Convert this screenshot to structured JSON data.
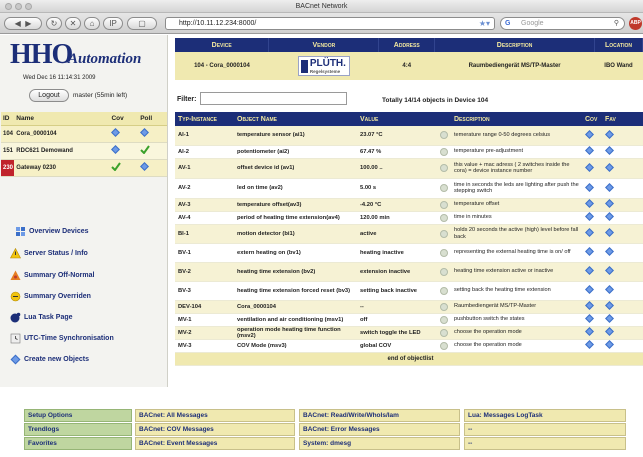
{
  "window": {
    "title": "BACnet Network"
  },
  "browser": {
    "url": "http://10.11.12.234:8000/",
    "search_placeholder": "Google",
    "addon_badge": "ABP"
  },
  "sidebar": {
    "logo_main": "HHO",
    "logo_sub": "Automation",
    "datetime": "Wed Dec 16 11:14:31 2009",
    "logout_label": "Logout",
    "user_status": "master (55min left)",
    "device_table": {
      "headers": [
        "ID",
        "Name",
        "Cov",
        "Poll"
      ],
      "rows": [
        {
          "id": "104",
          "name": "Cora_0000104",
          "cov": "arrow",
          "poll": "arrow"
        },
        {
          "id": "151",
          "name": "RDC621 Demowand",
          "cov": "arrow",
          "poll": "check"
        },
        {
          "id": "230",
          "name": "Gateway 0230",
          "cov": "check",
          "poll": "arrow"
        }
      ]
    },
    "menu": [
      {
        "label": "Overview Devices",
        "icon": "device-list-icon"
      },
      {
        "label": "Server Status / Info",
        "icon": "warning-triangle-icon"
      },
      {
        "label": "Summary Off-Normal",
        "icon": "alarm-icon"
      },
      {
        "label": "Summary Overriden",
        "icon": "override-icon"
      },
      {
        "label": "Lua Task Page",
        "icon": "lua-icon"
      },
      {
        "label": "UTC-Time Synchronisation",
        "icon": "clock-icon"
      },
      {
        "label": "Create new Objects",
        "icon": "create-object-icon"
      }
    ]
  },
  "device_header": {
    "headers": [
      "Device",
      "Vendor",
      "Address",
      "Description",
      "Location"
    ],
    "device": "104 - Cora_0000104",
    "vendor_logo": "PLÜTH.",
    "vendor_logo_sub": "Regelsysteme",
    "address": "4:4",
    "description": "Raumbediengerät MS/TP-Master",
    "location": "IBO Wand"
  },
  "filter": {
    "label": "Filter:",
    "value": ""
  },
  "object_summary": "Totally 14/14 objects in Device 104",
  "objects": {
    "headers": [
      "Typ-Instance",
      "Object Name",
      "Value",
      "",
      "Description",
      "Cov",
      "Fav"
    ],
    "rows": [
      {
        "type": "AI-1",
        "name": "temperature sensor (ai1)",
        "value": "23.07 °C",
        "desc": "temerature range 0-50 degrees celsius"
      },
      {
        "type": "AI-2",
        "name": "potentiometer (ai2)",
        "value": "67.47 %",
        "desc": "temperature pre-adjustment"
      },
      {
        "type": "AV-1",
        "name": "offset device id (av1)",
        "value": "100.00 ..",
        "desc": "this value + mac adress ( 2 switches inside the cora) = device instance number"
      },
      {
        "type": "AV-2",
        "name": "led on time (av2)",
        "value": "5.00 s",
        "desc": "time in seconds the leds are lighting after push the stepping switch"
      },
      {
        "type": "AV-3",
        "name": "temperature offset(av3)",
        "value": "-4.20 °C",
        "desc": "temperature offset"
      },
      {
        "type": "AV-4",
        "name": "period of heating time extension(av4)",
        "value": "120.00 min",
        "desc": "time in minutes"
      },
      {
        "type": "BI-1",
        "name": "motion detector (bi1)",
        "value": "active",
        "desc": "holds 20 seconds the active (high) level before fall back"
      },
      {
        "type": "BV-1",
        "name": "extern heating on (bv1)",
        "value": "heating inactive",
        "desc": "representing the external heating time is on/ off"
      },
      {
        "type": "BV-2",
        "name": "heating time extension (bv2)",
        "value": "extension inactive",
        "desc": "heating time extension active or inactive"
      },
      {
        "type": "BV-3",
        "name": "heating time extension forced reset (bv3)",
        "value": "setting back inactive",
        "desc": "setting back the heating time extension"
      },
      {
        "type": "DEV-104",
        "name": "Cora_0000104",
        "value": "--",
        "desc": "Raumbediengerät MS/TP-Master"
      },
      {
        "type": "MV-1",
        "name": "ventilation and air conditioning (msv1)",
        "value": "off",
        "desc": "pushbutton switch the states"
      },
      {
        "type": "MV-2",
        "name": "operation mode heating time function (msv2)",
        "value": "switch toggle the LED",
        "desc": "choose the operation mode"
      },
      {
        "type": "MV-3",
        "name": "COV Mode (msv3)",
        "value": "global COV",
        "desc": "choose the operation mode"
      }
    ],
    "end_label": "end of objectlist"
  },
  "bottom_menu": [
    [
      "Setup Options",
      "BACnet: All Messages",
      "BACnet: Read/Write/WhoIs/Iam",
      "Lua: Messages LogTask"
    ],
    [
      "Trendlogs",
      "BACnet: COV Messages",
      "BACnet: Error Messages",
      "--"
    ],
    [
      "Favorites",
      "BACnet: Event Messages",
      "System: dmesg",
      "--"
    ]
  ],
  "colors": {
    "navy": "#1c2e78",
    "header_text": "#f3e9a0",
    "row_yellow": "#f6f2d4",
    "green_button": "#bfd6a0"
  }
}
